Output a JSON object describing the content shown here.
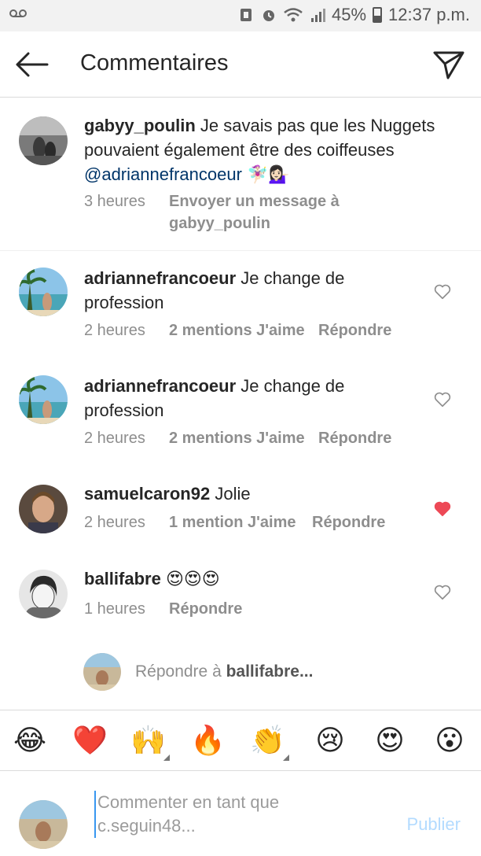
{
  "status_bar": {
    "voicemail_icon": "voicemail-icon",
    "battery": "45%",
    "time": "12:37 p.m."
  },
  "header": {
    "title": "Commentaires"
  },
  "comments": [
    {
      "username": "gabyy_poulin",
      "text": "Je savais pas que les Nuggets pouvaient également être des coiffeuses",
      "mention": "@adriannefrancoeur",
      "emoji": "🧚🏻‍♀️💁🏻‍♀️",
      "time": "3 heures",
      "action": "Envoyer un message à gabyy_poulin"
    },
    {
      "username": "adriannefrancoeur",
      "text": "Je change de profession",
      "time": "2 heures",
      "likes": "2 mentions J'aime",
      "reply": "Répondre",
      "liked": false
    },
    {
      "username": "adriannefrancoeur",
      "text": "Je change de profession",
      "time": "2 heures",
      "likes": "2 mentions J'aime",
      "reply": "Répondre",
      "liked": false
    },
    {
      "username": "samuelcaron92",
      "text": "Jolie",
      "time": "2 heures",
      "likes": "1 mention J'aime",
      "reply": "Répondre",
      "liked": true
    },
    {
      "username": "ballifabre",
      "text": "😍😍😍",
      "time": "1 heures",
      "reply": "Répondre",
      "liked": false
    }
  ],
  "reply_row": {
    "prefix": "Répondre à",
    "target": "ballifabre..."
  },
  "emoji_bar": [
    "😂",
    "❤️",
    "🙌",
    "🔥",
    "👏",
    "😢",
    "😍",
    "😮"
  ],
  "compose": {
    "placeholder_line1": "Commenter en tant que",
    "placeholder_line2": "c.seguin48...",
    "publish": "Publier"
  },
  "colors": {
    "liked_heart": "#ed4956",
    "link": "#003569",
    "publish_disabled": "#b3dbff"
  }
}
